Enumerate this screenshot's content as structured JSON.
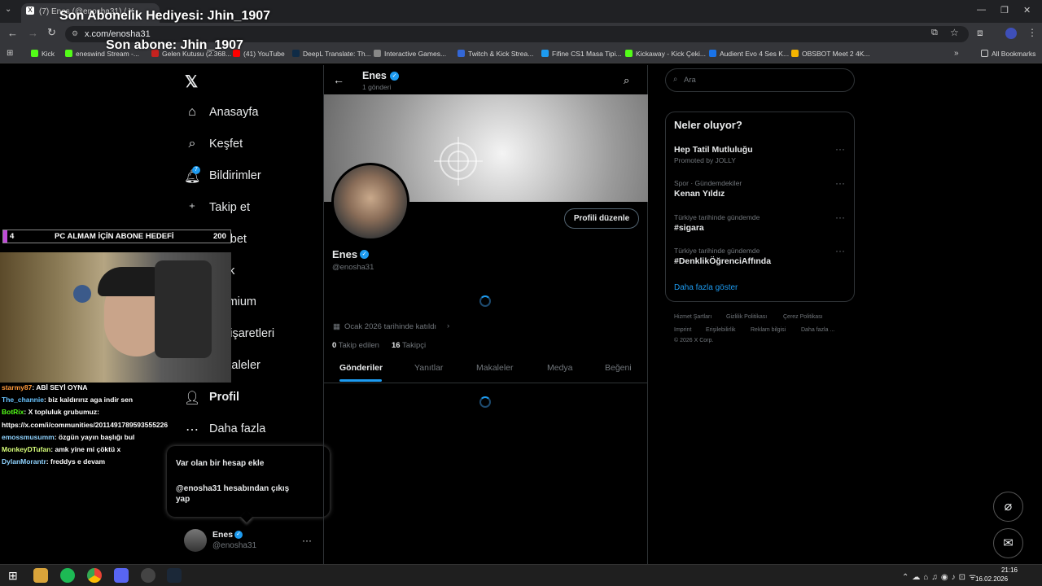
{
  "browser": {
    "tab_title": "(7) Enes (@enosha31) / X",
    "url": "x.com/enosha31",
    "bookmarks": [
      "Kick",
      "eneswind Stream -...",
      "Gelen Kutusu (2.368...",
      "(41) YouTube",
      "DeepL Translate: Th...",
      "Interactive Games...",
      "Twitch & Kick Strea...",
      "Fifine CS1 Masa Tipi...",
      "Kickaway - Kick Çeki...",
      "Audient Evo 4 Ses K...",
      "OBSBOT Meet 2 4K..."
    ],
    "all_bookmarks": "All Bookmarks"
  },
  "nav": {
    "items": [
      "Anasayfa",
      "Keşfet",
      "Bildirimler",
      "Takip et",
      "Sohbet",
      "Grok",
      "Premium",
      "Yer işaretleri",
      "Makaleler",
      "Profil",
      "Daha fazla"
    ],
    "notif_badge": "7"
  },
  "account_menu": {
    "add": "Var olan bir hesap ekle",
    "logout": "@enosha31 hesabından çıkış yap"
  },
  "account": {
    "name": "Enes",
    "handle": "@enosha31"
  },
  "profile": {
    "header_name": "Enes",
    "post_count": "1 gönderi",
    "name": "Enes",
    "handle": "@enosha31",
    "edit_button": "Profili düzenle",
    "joined": "Ocak 2026 tarihinde katıldı",
    "following_count": "0",
    "following_label": "Takip edilen",
    "followers_count": "16",
    "followers_label": "Takipçi",
    "tabs": [
      "Gönderiler",
      "Yanıtlar",
      "Makaleler",
      "Medya",
      "Beğeni"
    ]
  },
  "sidebar": {
    "search_placeholder": "Ara",
    "trends_title": "Neler oluyor?",
    "trends": [
      {
        "category": "",
        "title": "Hep Tatil Mutluluğu",
        "sub": "Promoted by JOLLY"
      },
      {
        "category": "Spor · Gündemdekiler",
        "title": "Kenan Yıldız",
        "sub": ""
      },
      {
        "category": "Türkiye tarihinde gündemde",
        "title": "#sigara",
        "sub": ""
      },
      {
        "category": "Türkiye tarihinde gündemde",
        "title": "#DenklikÖğrenciAffında",
        "sub": ""
      }
    ],
    "show_more": "Daha fazla göster",
    "footer": [
      "Hizmet Şartları",
      "Gizlilik Politikası",
      "Çerez Politikası",
      "Imprint",
      "Erişilebilirlik",
      "Reklam bilgisi",
      "Daha fazla ...",
      "© 2026 X Corp."
    ]
  },
  "overlay": {
    "sub_gift": "Son Abonelik Hediyesi: Jhin_1907",
    "last_sub": "Son abone: Jhin_1907",
    "goal_current": "4",
    "goal_label": "PC ALMAM İÇİN ABONE HEDEFİ",
    "goal_target": "200",
    "chat": [
      {
        "user": "starmy87",
        "msg": ": ABİ SEYİ OYNA"
      },
      {
        "user": "The_channie",
        "msg": ": biz kaldırırız aga indir sen"
      },
      {
        "user": "BotRix",
        "msg": ": X topluluk grubumuz:"
      },
      {
        "user": "",
        "msg": "https://x.com/i/communities/2011491789593555226"
      },
      {
        "user": "emossmusumm",
        "msg": ": özgün yayın başlığı bul"
      },
      {
        "user": "MonkeyDTufan",
        "msg": ": amk yine mi çöktü x"
      },
      {
        "user": "DylanMorantr",
        "msg": ": freddys e devam"
      }
    ]
  },
  "taskbar": {
    "time": "21:16",
    "date": "16.02.2026"
  }
}
